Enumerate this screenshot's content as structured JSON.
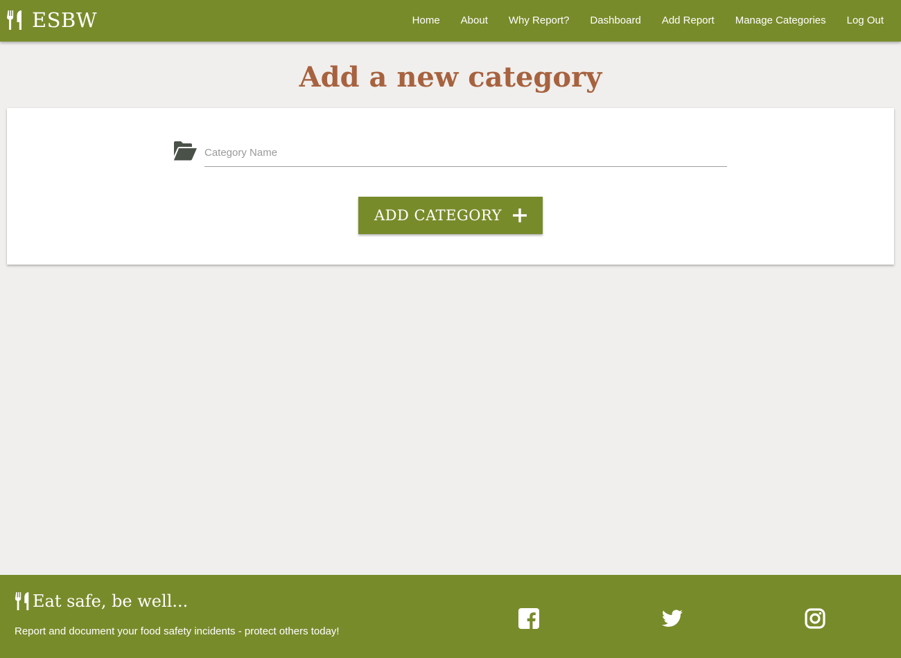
{
  "nav": {
    "brand": "ESBW",
    "links": [
      "Home",
      "About",
      "Why Report?",
      "Dashboard",
      "Add Report",
      "Manage Categories",
      "Log Out"
    ]
  },
  "main": {
    "title": "Add a new category",
    "form": {
      "category_placeholder": "Category Name",
      "category_value": "",
      "submit_label": "ADD CATEGORY"
    }
  },
  "footer": {
    "tagline": "Eat safe, be well...",
    "text": "Report and document your food safety incidents - protect others today!",
    "social": [
      "facebook-icon",
      "twitter-icon",
      "instagram-icon"
    ]
  },
  "colors": {
    "primary": "#788b2b",
    "title": "#a7623f",
    "background": "#f0efed",
    "icon_dark": "#4a5149"
  }
}
